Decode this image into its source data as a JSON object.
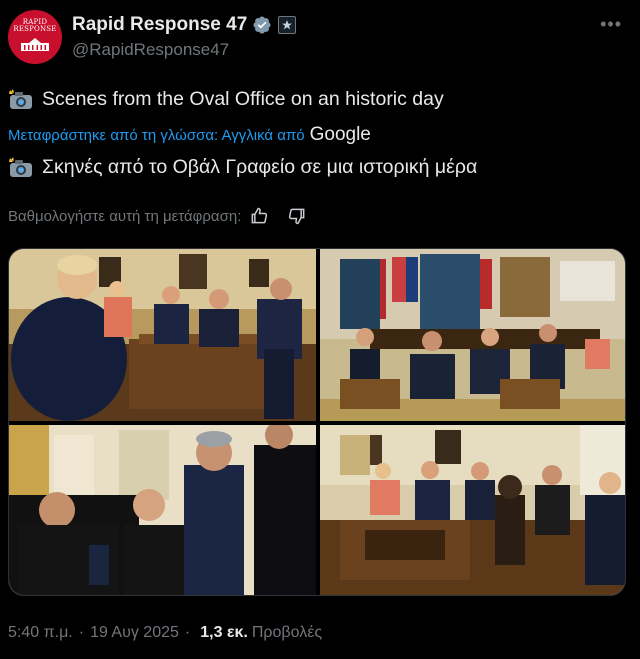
{
  "author": {
    "display_name": "Rapid Response 47",
    "handle": "@RapidResponse47",
    "avatar_text_line1": "RAPID",
    "avatar_text_line2": "RESPONSE"
  },
  "tweet": {
    "text_original": "Scenes from the Oval Office on an historic day",
    "translated_label": "Μεταφράστηκε από τη γλώσσα: Αγγλικά από",
    "translated_provider": "Google",
    "text_translated": "Σκηνές από το Οβάλ Γραφείο σε μια ιστορική μέρα",
    "rate_label": "Βαθμολογήστε αυτή τη μετάφραση:"
  },
  "meta": {
    "time": "5:40 π.μ.",
    "separator": "·",
    "date": "19 Αυγ 2025",
    "views_count": "1,3 εκ.",
    "views_label": "Προβολές"
  },
  "icons": [
    "camera-emoji-icon",
    "verified-badge-icon",
    "affiliate-badge-icon",
    "more-icon",
    "thumbs-up-icon",
    "thumbs-down-icon"
  ],
  "colors": {
    "link": "#1d9bf0",
    "muted": "#71767b",
    "text": "#e7e9ea",
    "background": "#000000",
    "verified": "#829aab"
  }
}
